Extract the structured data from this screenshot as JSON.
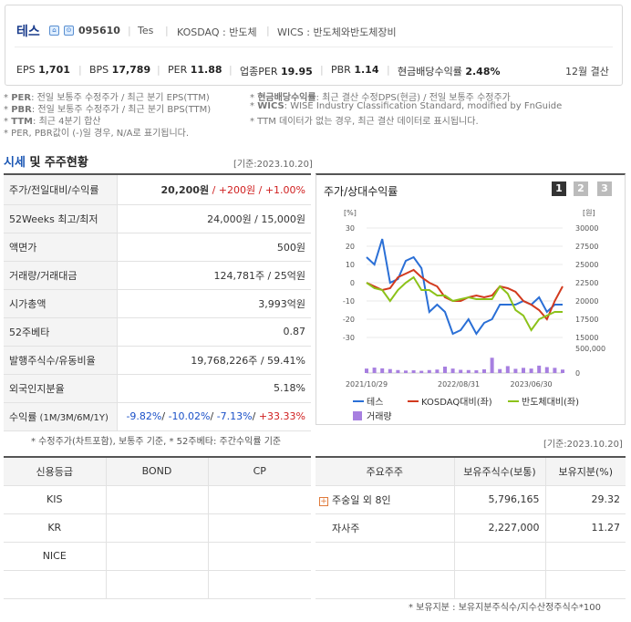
{
  "header": {
    "name": "테스",
    "code": "095610",
    "eng": "Tes",
    "market": "KOSDAQ : 반도체",
    "wics": "WICS : 반도체와반도체장비",
    "metrics": [
      {
        "label": "EPS",
        "value": "1,701"
      },
      {
        "label": "BPS",
        "value": "17,789"
      },
      {
        "label": "PER",
        "value": "11.88"
      },
      {
        "label": "업종PER",
        "value": "19.95"
      },
      {
        "label": "PBR",
        "value": "1.14"
      },
      {
        "label": "현금배당수익률",
        "value": "2.48%"
      }
    ],
    "settle": "12월 결산"
  },
  "notes": {
    "l1k": "PER",
    "l1": ": 전일 보통주 수정주가 / 최근 분기 EPS(TTM)",
    "l2k": "PBR",
    "l2": ": 전일 보통주 수정주가 / 최근 분기 BPS(TTM)",
    "l3k": "TTM",
    "l3": ": 최근 4분기 합산",
    "l4": "* PER, PBR값이 (-)일 경우, N/A로 표기됩니다.",
    "r1k": "현금배당수익률",
    "r1": ": 최근 결산 수정DPS(현금) / 전일 보통주 수정주가",
    "r2k": "WICS",
    "r2": ": WISE Industry Classification Standard, modified by FnGuide",
    "r3": "* TTM 데이터가 없는 경우, 최근 결산 데이터로 표시됩니다."
  },
  "section": {
    "title_a": "시세",
    "title_b": " 및 주주현황",
    "date": "[기준:2023.10.20]"
  },
  "quote": [
    {
      "k": "주가/전일대비/수익률",
      "v1": "20,200원",
      "v2": " / +200원",
      "v3": " / +1.00%"
    },
    {
      "k": "52Weeks 최고/최저",
      "v": "24,000원 / 15,000원"
    },
    {
      "k": "액면가",
      "v": "500원"
    },
    {
      "k": "거래량/거래대금",
      "v": "124,781주 / 25억원"
    },
    {
      "k": "시가총액",
      "v": "3,993억원"
    },
    {
      "k": "52주베타",
      "v": "0.87"
    },
    {
      "k": "발행주식수/유동비율",
      "v": "19,768,226주 / 59.41%"
    },
    {
      "k": "외국인지분율",
      "v": "5.18%"
    },
    {
      "k": "수익률",
      "sub": " (1M/3M/6M/1Y)",
      "r1": "-9.82%",
      "r2": "-10.02%",
      "r3": "-7.13%",
      "r4": "+33.33%"
    }
  ],
  "quote_note": "* 수정주가(차트포함), 보통주 기준, * 52주베타: 주간수익률 기준",
  "chart": {
    "title": "주가/상대수익률",
    "pages": [
      "1",
      "2",
      "3"
    ],
    "unit_left": "[%]",
    "unit_right": "[원]",
    "left_ticks": [
      "30",
      "20",
      "10",
      "0",
      "-10",
      "-20",
      "-30"
    ],
    "right_ticks": [
      "30000",
      "27500",
      "25000",
      "22500",
      "20000",
      "17500",
      "15000"
    ],
    "vol_ticks": [
      "500,000",
      "0"
    ],
    "x_ticks": [
      "2021/10/29",
      "2022/08/31",
      "2023/06/30"
    ],
    "legend": [
      "테스",
      "KOSDAQ대비(좌)",
      "반도체대비(좌)",
      "거래량"
    ],
    "colors": {
      "price": "#2a6fd6",
      "kosdaq": "#d23a1e",
      "semi": "#8cc21a",
      "volume": "#a77fe0"
    }
  },
  "chart_data": {
    "type": "line",
    "x_range": [
      "2021/10/29",
      "2023/10/20"
    ],
    "series": [
      {
        "name": "테스",
        "axis": "right",
        "values": [
          26000,
          25000,
          28500,
          22500,
          23000,
          25500,
          26000,
          24500,
          18500,
          19500,
          18500,
          15500,
          16000,
          17500,
          15500,
          17000,
          17500,
          19500,
          19500,
          19500,
          20000,
          19500,
          20500,
          18500,
          19500,
          19500
        ]
      },
      {
        "name": "KOSDAQ대비(좌)",
        "values": [
          0,
          -2,
          -4,
          -3,
          3,
          5,
          7,
          3,
          0,
          -2,
          -8,
          -10,
          -10,
          -8,
          -7,
          -8,
          -7,
          -2,
          -3,
          -5,
          -10,
          -12,
          -15,
          -20,
          -10,
          -2
        ]
      },
      {
        "name": "반도체대비(좌)",
        "values": [
          0,
          -3,
          -4,
          -10,
          -4,
          0,
          3,
          -4,
          -4,
          -7,
          -7,
          -10,
          -9,
          -8,
          -9,
          -9,
          -9,
          -2,
          -6,
          -15,
          -18,
          -26,
          -20,
          -18,
          -16,
          -16
        ]
      },
      {
        "name": "거래량",
        "axis": "volume",
        "values": [
          90000,
          110000,
          95000,
          80000,
          60000,
          50000,
          55000,
          45000,
          60000,
          70000,
          130000,
          90000,
          65000,
          60000,
          55000,
          75000,
          310000,
          80000,
          140000,
          85000,
          105000,
          90000,
          150000,
          120000,
          105000,
          70000
        ]
      }
    ],
    "ylim_left": [
      -30,
      30
    ],
    "ylim_right": [
      15000,
      30000
    ]
  },
  "credit": {
    "headers": [
      "신용등급",
      "BOND",
      "CP"
    ],
    "rows": [
      "KIS",
      "KR",
      "NICE"
    ]
  },
  "holders": {
    "date": "[기준:2023.10.20]",
    "headers": [
      "주요주주",
      "보유주식수(보통)",
      "보유지분(%)"
    ],
    "rows": [
      {
        "name": "주숭일 외 8인",
        "shares": "5,796,165",
        "pct": "29.32"
      },
      {
        "name": "자사주",
        "shares": "2,227,000",
        "pct": "11.27"
      }
    ],
    "note": "* 보유지분 : 보유지분주식수/지수산정주식수*100"
  }
}
